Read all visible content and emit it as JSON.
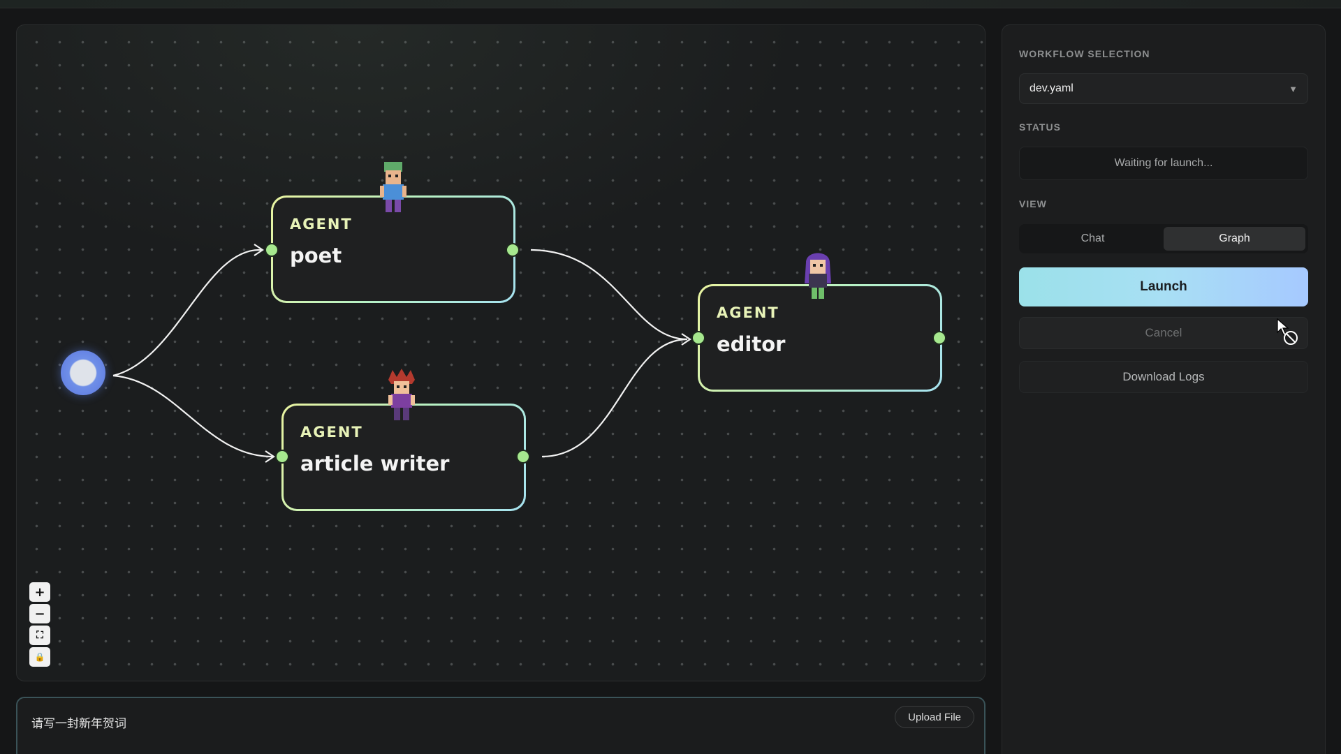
{
  "sidebar": {
    "workflow_label": "WORKFLOW SELECTION",
    "workflow_value": "dev.yaml",
    "status_label": "STATUS",
    "status_text": "Waiting for launch...",
    "view_label": "VIEW",
    "view_tabs": [
      {
        "label": "Chat",
        "active": false
      },
      {
        "label": "Graph",
        "active": true
      }
    ],
    "launch_label": "Launch",
    "cancel_label": "Cancel",
    "download_label": "Download Logs"
  },
  "graph": {
    "nodes": [
      {
        "kind": "AGENT",
        "name": "poet"
      },
      {
        "kind": "AGENT",
        "name": "article writer"
      },
      {
        "kind": "AGENT",
        "name": "editor"
      }
    ],
    "zoom_controls": [
      "+",
      "−",
      "⛶",
      "🔒"
    ]
  },
  "input": {
    "text": "请写一封新年贺词",
    "upload_label": "Upload File"
  },
  "colors": {
    "accent_green": "#a6e88e",
    "launch_gradient_start": "#9be1e9",
    "launch_gradient_end": "#a6c9ff",
    "start_node": "#5c78e0"
  },
  "icons": {
    "dropdown": "caret-down-icon",
    "zoom_in": "plus-icon",
    "zoom_out": "minus-icon",
    "fit_view": "fit-view-icon",
    "lock": "lock-icon",
    "cursor": "not-allowed-cursor-icon"
  }
}
